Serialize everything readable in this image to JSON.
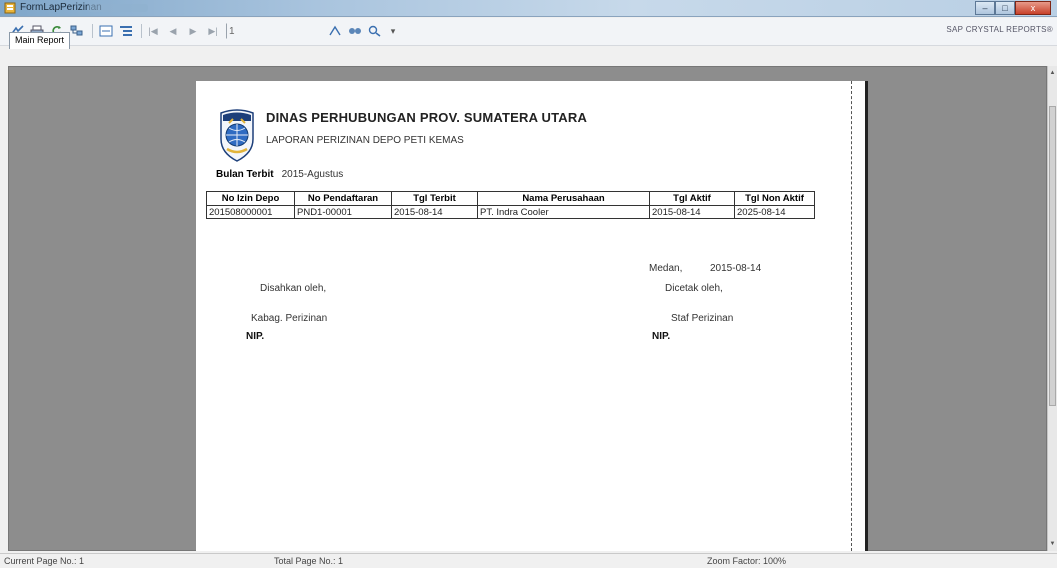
{
  "window": {
    "title": "FormLapPerizinan",
    "buttons": {
      "minimize": "–",
      "maximize": "□",
      "close": "x"
    }
  },
  "toolbar": {
    "page_value": "1",
    "brand": "SAP CRYSTAL REPORTS®"
  },
  "tabs": [
    {
      "label": "Main Report"
    }
  ],
  "report": {
    "org_name": "DINAS PERHUBUNGAN PROV. SUMATERA UTARA",
    "report_title": "LAPORAN PERIZINAN DEPO PETI KEMAS",
    "bulan_label": "Bulan Terbit",
    "bulan_value": "2015-Agustus",
    "table": {
      "headers": [
        "No Izin Depo",
        "No Pendaftaran",
        "Tgl Terbit",
        "Nama Perusahaan",
        "Tgl Aktif",
        "Tgl Non Aktif"
      ],
      "rows": [
        [
          "201508000001",
          "PND1-00001",
          "2015-08-14",
          "PT. Indra Cooler",
          "2015-08-14",
          "2025-08-14"
        ]
      ]
    },
    "place_label": "Medan,",
    "place_date": "2015-08-14",
    "left_sig": {
      "label": "Disahkan oleh,",
      "position": "Kabag. Perizinan",
      "nip": "NIP."
    },
    "right_sig": {
      "label": "Dicetak oleh,",
      "position": "Staf Perizinan",
      "nip": "NIP."
    }
  },
  "status": {
    "current_page": "Current Page No.: 1",
    "total_page": "Total Page No.: 1",
    "zoom": "Zoom Factor: 100%"
  },
  "colors": {
    "viewer_bg": "#8d8d8d",
    "titlebar": "#a9c4de",
    "close_button": "#c8412a"
  }
}
